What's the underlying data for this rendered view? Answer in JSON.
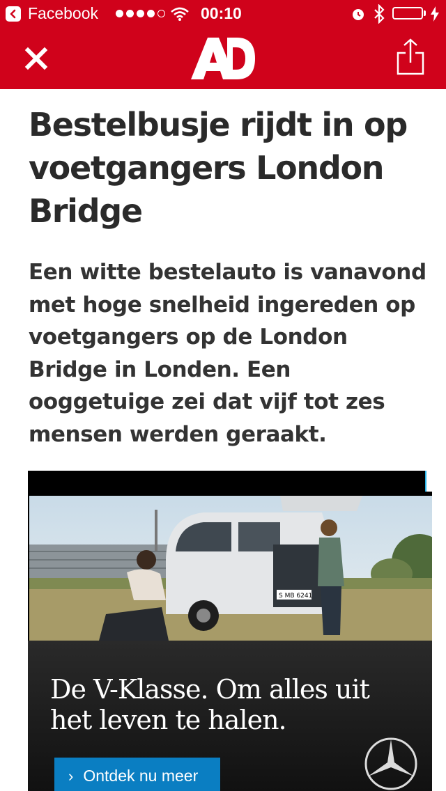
{
  "status_bar": {
    "app_name": "Facebook",
    "time": "00:10",
    "signal": "●●●●○",
    "icons": [
      "back-arrow-icon",
      "wifi-icon",
      "alarm-icon",
      "bluetooth-icon",
      "battery-icon",
      "charging-bolt-icon"
    ]
  },
  "nav": {
    "logo_text": "AD",
    "close_icon": "close-icon",
    "share_icon": "share-icon"
  },
  "article": {
    "headline": "Bestelbusje rijdt in op voetgangers London Bridge",
    "intro": "Een witte bestelauto is vanavond met hoge snelheid ingereden op voetgangers op de London Bridge in Londen. Een ooggetuige zei dat vijf tot zes mensen werden geraakt."
  },
  "ad": {
    "tagline": "De V-Klasse. Om alles uit het leven te halen.",
    "cta_label": "Ontdek nu meer",
    "plate_text": "S MB 6241"
  },
  "colors": {
    "brand_red": "#d0021b",
    "cta_blue": "#0a7ec2",
    "text_dark": "#2a2a2a"
  }
}
